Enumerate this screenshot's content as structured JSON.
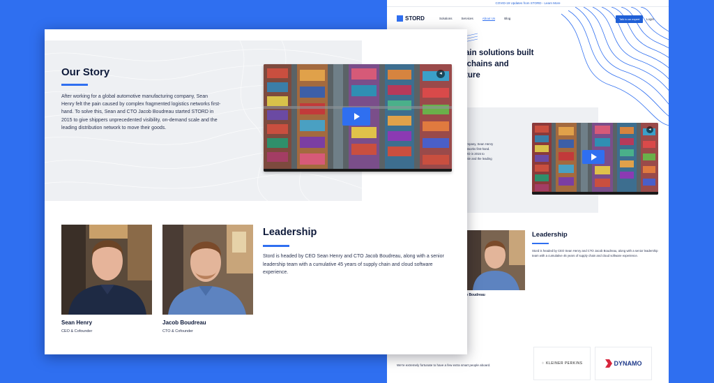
{
  "background_page": {
    "covid_banner": "COVID-19 Updates from STORD - Learn More",
    "logo_text": "STORD",
    "nav": {
      "items": [
        "Solutions",
        "Services",
        "About Us",
        "Blog"
      ],
      "active_index": 2,
      "cta": "Talk to an expert",
      "login": "Login"
    },
    "hero_title": [
      "hain solutions built",
      "y chains and",
      "uture"
    ],
    "story_excerpt": [
      "company, Sean Henry",
      "networks first-hand.",
      "ORD in 2015 to",
      "scale and the leading"
    ],
    "leader_name": "b Boudreau",
    "leader_role": "r",
    "leadership_title": "Leadership",
    "leadership_text": "Stord is headed by CEO Sean Henry and CTO Jacob Boudreau, along with a senior leadership team with a cumulative 45 years of supply chain and cloud software experience.",
    "investors": {
      "intro": "We're extremely fortunate to have a few extra smart people aboard.",
      "logos": [
        "KLEINER PERKINS",
        "DYNAMO"
      ]
    }
  },
  "card": {
    "story": {
      "title": "Our Story",
      "body": "After working for a global automotive manufacturing company, Sean Henry felt the pain caused by complex fragmented logistics networks first-hand. To solve this, Sean and CTO Jacob Boudreau started STORD in 2015 to give shippers unprecedented visibility, on-demand scale and the leading distribution network to move their goods."
    },
    "leaders": [
      {
        "name": "Sean Henry",
        "role": "CEO & Cofounder"
      },
      {
        "name": "Jacob Boudreau",
        "role": "CTO & Cofounder"
      }
    ],
    "leadership": {
      "title": "Leadership",
      "body": "Stord is headed by CEO Sean Henry and CTO Jacob Boudreau, along with a senior leadership team with a cumulative 45 years of supply chain and cloud software experience."
    }
  },
  "colors": {
    "brand_blue": "#2f6ff0",
    "navy_text": "#0e1a3a",
    "panel_gray": "#eef0f3"
  },
  "icons": [
    "play-icon",
    "mute-icon",
    "stord-logo-icon",
    "dynamo-logo-icon"
  ]
}
